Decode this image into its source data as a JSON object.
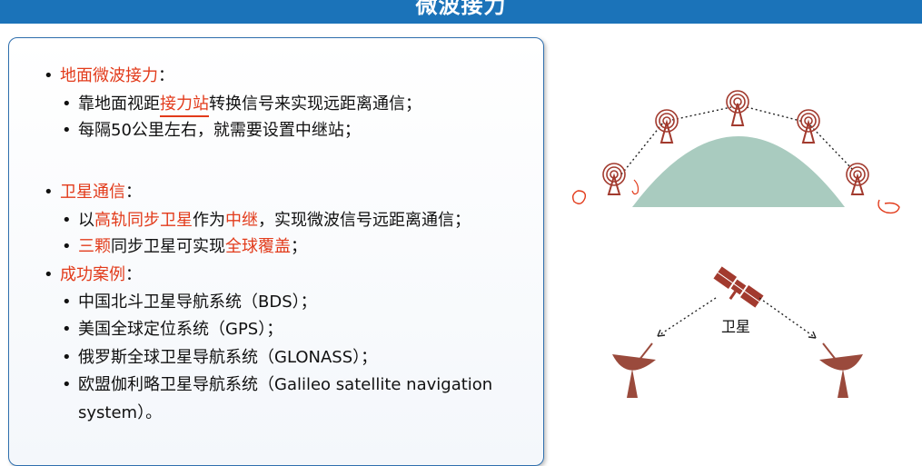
{
  "page_title": "微波接力",
  "sections": [
    {
      "heading": "地面微波接力",
      "items": [
        [
          "靠地面视距",
          {
            "t": "接力站",
            "red": true,
            "u": true
          },
          "转换信号来实现远距离通信；"
        ],
        [
          "每隔50公里左右，就需要设置中继站；"
        ]
      ]
    },
    {
      "heading": "卫星通信",
      "items": [
        [
          "以",
          {
            "t": "高轨同步卫星",
            "red": true
          },
          "作为",
          {
            "t": "中继",
            "red": true
          },
          "，实现微波信号远距离通信；"
        ],
        [
          {
            "t": "三颗",
            "red": true
          },
          "同步卫星可实现",
          {
            "t": "全球覆盖",
            "red": true
          },
          "；"
        ]
      ]
    },
    {
      "heading": "成功案例",
      "items": [
        [
          "中国北斗卫星导航系统（BDS）；"
        ],
        [
          "美国全球定位系统（GPS）；"
        ],
        [
          "俄罗斯全球卫星导航系统（GLONASS）；"
        ],
        [
          "欧盟伽利略卫星导航系统（Galileo satellite navigation"
        ],
        [
          "system）。"
        ]
      ]
    }
  ],
  "bullet": "•",
  "diagram": {
    "satellite_label": "卫星"
  },
  "colors": {
    "title_bar": "#1b73b9",
    "accent_red": "#e23b1b",
    "tower": "#a23a2e",
    "earth": "#a9cbbf",
    "dish": "#9a4a3c"
  }
}
